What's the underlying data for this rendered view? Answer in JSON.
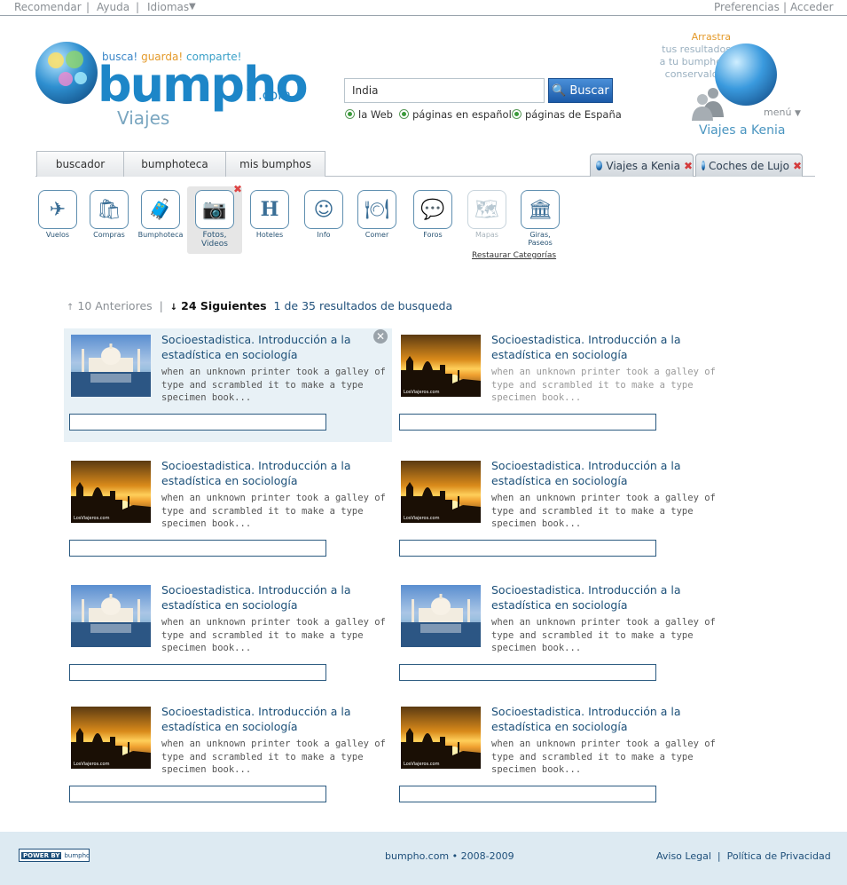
{
  "topbar": {
    "recomendar": "Recomendar",
    "ayuda": "Ayuda",
    "idiomas": "Idiomas",
    "preferencias": "Preferencias",
    "acceder": "Acceder",
    "separator": "|"
  },
  "logo": {
    "tag_busca": "busca!",
    "tag_guarda": "guarda!",
    "tag_comparte": "comparte!",
    "brand": "bumpho",
    "brand_com": "™.com",
    "section": "Viajes"
  },
  "search": {
    "value": "India",
    "button": "Buscar",
    "options": [
      "la Web",
      "páginas en español",
      "páginas de España"
    ]
  },
  "drag": {
    "line1": "Arrastra",
    "line2": "tus resultados",
    "line3": "a tu bumpho y",
    "line4": "conservalos!!",
    "menu": "menú",
    "bumpho_name": "Viajes a Kenia"
  },
  "tabs": {
    "main": [
      "buscador",
      "bumphoteca",
      "mis bumphos"
    ],
    "bumphos": [
      "Viajes a Kenia",
      "Coches de Lujo"
    ],
    "close_glyph": "✖"
  },
  "categories": [
    {
      "label": "Vuelos",
      "icon": "plane-icon",
      "glyph": "✈"
    },
    {
      "label": "Compras",
      "icon": "shopping-bags-icon",
      "glyph": "🛍"
    },
    {
      "label": "Bumphoteca",
      "icon": "suitcase-icon",
      "glyph": "🧳"
    },
    {
      "label": "Fotos, Videos",
      "icon": "camera-icon",
      "glyph": "📷"
    },
    {
      "label": "Hoteles",
      "icon": "hotel-icon",
      "glyph": "H"
    },
    {
      "label": "Info",
      "icon": "info-person-icon",
      "glyph": "☺"
    },
    {
      "label": "Comer",
      "icon": "plate-icon",
      "glyph": "🍽"
    },
    {
      "label": "Foros",
      "icon": "forum-icon",
      "glyph": "💬"
    },
    {
      "label": "Mapas",
      "icon": "map-icon",
      "glyph": "🗺"
    },
    {
      "label": "Giras, Paseos",
      "icon": "tour-icon",
      "glyph": "🏛"
    }
  ],
  "restore": "Restaurar Categorías",
  "pager": {
    "prev": "10 Anteriores",
    "sep": "|",
    "next": "24 Siguientes",
    "summary": "1 de 35 resultados de busqueda",
    "up_arrow": "↑",
    "down_arrow": "↓"
  },
  "results": [
    {
      "title": "Socioestadistica. Introducción a la estadística en sociología",
      "desc": "when an unknown printer took a galley of type and scrambled it to make a type specimen book...",
      "image": "taj-mahal"
    },
    {
      "title": "Socioestadistica. Introducción a la estadística en sociología",
      "desc": "when an unknown printer took a galley of type and scrambled it to make a type specimen book...",
      "image": "sunset",
      "watermark": "LosViajeros.com"
    },
    {
      "title": "Socioestadistica. Introducción a la estadística en sociología",
      "desc": "when an unknown printer took a galley of type and scrambled it to make a type specimen book...",
      "image": "sunset",
      "watermark": "LosViajeros.com"
    },
    {
      "title": "Socioestadistica. Introducción a la estadística en sociología",
      "desc": "when an unknown printer took a galley of type and scrambled it to make a type specimen book...",
      "image": "sunset",
      "watermark": "LosViajeros.com"
    },
    {
      "title": "Socioestadistica. Introducción a la estadística en sociología",
      "desc": "when an unknown printer took a galley of type and scrambled it to make a type specimen book...",
      "image": "taj-mahal"
    },
    {
      "title": "Socioestadistica. Introducción a la estadística en sociología",
      "desc": "when an unknown printer took a galley of type and scrambled it to make a type specimen book...",
      "image": "taj-mahal"
    },
    {
      "title": "Socioestadistica. Introducción a la estadística en sociología",
      "desc": "when an unknown printer took a galley of type and scrambled it to make a type specimen book...",
      "image": "sunset",
      "watermark": "LosViajeros.com"
    },
    {
      "title": "Socioestadistica. Introducción a la estadística en sociología",
      "desc": "when an unknown printer took a galley of type and scrambled it to make a type specimen book...",
      "image": "sunset",
      "watermark": "LosViajeros.com"
    }
  ],
  "footer": {
    "powered_by": "POWER BY",
    "powered_brand": "bumpho",
    "copyright": "bumpho.com • 2008-2009",
    "aviso": "Aviso Legal",
    "sep": "|",
    "privacidad": "Política de Privacidad"
  },
  "colors": {
    "brand_blue": "#1d86c8",
    "link_blue": "#1b4f78",
    "orange": "#e49a2a",
    "highlight": "#e8f1f6",
    "footer_bg": "#ddeaf2"
  }
}
